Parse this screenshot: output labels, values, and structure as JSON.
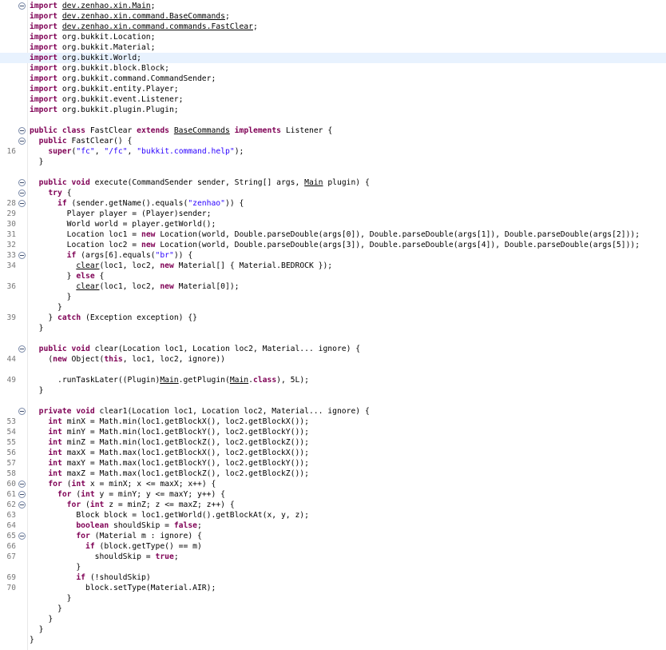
{
  "lines": [
    {
      "ln": "",
      "fold": true,
      "hl": false,
      "segs": [
        [
          "import ",
          "k"
        ],
        [
          "dev.zenhao.xin.Main",
          "u"
        ],
        [
          ";",
          ""
        ]
      ]
    },
    {
      "ln": "",
      "fold": false,
      "hl": false,
      "segs": [
        [
          "import ",
          "k"
        ],
        [
          "dev.zenhao.xin.command.BaseCommands",
          "u"
        ],
        [
          ";",
          ""
        ]
      ]
    },
    {
      "ln": "",
      "fold": false,
      "hl": false,
      "segs": [
        [
          "import ",
          "k"
        ],
        [
          "dev.zenhao.xin.command.commands.FastClear",
          "u"
        ],
        [
          ";",
          ""
        ]
      ]
    },
    {
      "ln": "",
      "fold": false,
      "hl": false,
      "segs": [
        [
          "import ",
          "k"
        ],
        [
          "org.bukkit.Location;",
          ""
        ]
      ]
    },
    {
      "ln": "",
      "fold": false,
      "hl": false,
      "segs": [
        [
          "import ",
          "k"
        ],
        [
          "org.bukkit.Material;",
          ""
        ]
      ]
    },
    {
      "ln": "",
      "fold": false,
      "hl": true,
      "segs": [
        [
          "import ",
          "k"
        ],
        [
          "org.bukkit.World;",
          ""
        ]
      ]
    },
    {
      "ln": "",
      "fold": false,
      "hl": false,
      "segs": [
        [
          "import ",
          "k"
        ],
        [
          "org.bukkit.block.Block;",
          ""
        ]
      ]
    },
    {
      "ln": "",
      "fold": false,
      "hl": false,
      "segs": [
        [
          "import ",
          "k"
        ],
        [
          "org.bukkit.command.CommandSender;",
          ""
        ]
      ]
    },
    {
      "ln": "",
      "fold": false,
      "hl": false,
      "segs": [
        [
          "import ",
          "k"
        ],
        [
          "org.bukkit.entity.Player;",
          ""
        ]
      ]
    },
    {
      "ln": "",
      "fold": false,
      "hl": false,
      "segs": [
        [
          "import ",
          "k"
        ],
        [
          "org.bukkit.event.Listener;",
          ""
        ]
      ]
    },
    {
      "ln": "",
      "fold": false,
      "hl": false,
      "segs": [
        [
          "import ",
          "k"
        ],
        [
          "org.bukkit.plugin.Plugin;",
          ""
        ]
      ]
    },
    {
      "ln": "",
      "fold": false,
      "hl": false,
      "segs": []
    },
    {
      "ln": "",
      "fold": true,
      "hl": false,
      "segs": [
        [
          "public class ",
          "k"
        ],
        [
          "FastClear ",
          ""
        ],
        [
          "extends ",
          "k"
        ],
        [
          "BaseCommands",
          "u"
        ],
        [
          " ",
          ""
        ],
        [
          "implements ",
          "k"
        ],
        [
          "Listener {",
          ""
        ]
      ]
    },
    {
      "ln": "",
      "fold": true,
      "hl": false,
      "segs": [
        [
          "  ",
          ""
        ],
        [
          "public ",
          "k"
        ],
        [
          "FastClear() {",
          ""
        ]
      ]
    },
    {
      "ln": "16",
      "fold": false,
      "hl": false,
      "segs": [
        [
          "    ",
          ""
        ],
        [
          "super",
          "k"
        ],
        [
          "(",
          ""
        ],
        [
          "\"fc\"",
          "s"
        ],
        [
          ", ",
          ""
        ],
        [
          "\"/fc\"",
          "s"
        ],
        [
          ", ",
          ""
        ],
        [
          "\"bukkit.command.help\"",
          "s"
        ],
        [
          ");",
          ""
        ]
      ]
    },
    {
      "ln": "",
      "fold": false,
      "hl": false,
      "segs": [
        [
          "  }",
          ""
        ]
      ]
    },
    {
      "ln": "",
      "fold": false,
      "hl": false,
      "segs": []
    },
    {
      "ln": "",
      "fold": true,
      "hl": false,
      "segs": [
        [
          "  ",
          ""
        ],
        [
          "public void ",
          "k"
        ],
        [
          "execute(CommandSender sender, String[] args, ",
          ""
        ],
        [
          "Main",
          "u"
        ],
        [
          " plugin) {",
          ""
        ]
      ]
    },
    {
      "ln": "",
      "fold": true,
      "hl": false,
      "segs": [
        [
          "    ",
          ""
        ],
        [
          "try ",
          "k"
        ],
        [
          "{",
          ""
        ]
      ]
    },
    {
      "ln": "28",
      "fold": true,
      "hl": false,
      "segs": [
        [
          "      ",
          ""
        ],
        [
          "if ",
          "k"
        ],
        [
          "(sender.getName().equals(",
          ""
        ],
        [
          "\"zenhao\"",
          "s"
        ],
        [
          ")) {",
          ""
        ]
      ]
    },
    {
      "ln": "29",
      "fold": false,
      "hl": false,
      "segs": [
        [
          "        Player player = (Player)sender;",
          ""
        ]
      ]
    },
    {
      "ln": "30",
      "fold": false,
      "hl": false,
      "segs": [
        [
          "        World world = player.getWorld();",
          ""
        ]
      ]
    },
    {
      "ln": "31",
      "fold": false,
      "hl": false,
      "segs": [
        [
          "        Location loc1 = ",
          ""
        ],
        [
          "new ",
          "k"
        ],
        [
          "Location(world, Double.parseDouble(args[0]), Double.parseDouble(args[1]), Double.parseDouble(args[2]));",
          ""
        ]
      ]
    },
    {
      "ln": "32",
      "fold": false,
      "hl": false,
      "segs": [
        [
          "        Location loc2 = ",
          ""
        ],
        [
          "new ",
          "k"
        ],
        [
          "Location(world, Double.parseDouble(args[3]), Double.parseDouble(args[4]), Double.parseDouble(args[5]));",
          ""
        ]
      ]
    },
    {
      "ln": "33",
      "fold": true,
      "hl": false,
      "segs": [
        [
          "        ",
          ""
        ],
        [
          "if ",
          "k"
        ],
        [
          "(args[6].equals(",
          ""
        ],
        [
          "\"br\"",
          "s"
        ],
        [
          ")) {",
          ""
        ]
      ]
    },
    {
      "ln": "34",
      "fold": false,
      "hl": false,
      "segs": [
        [
          "          ",
          ""
        ],
        [
          "clear",
          "u"
        ],
        [
          "(loc1, loc2, ",
          ""
        ],
        [
          "new ",
          "k"
        ],
        [
          "Material[] { Material.BEDROCK });",
          ""
        ]
      ]
    },
    {
      "ln": "",
      "fold": false,
      "hl": false,
      "segs": [
        [
          "        } ",
          ""
        ],
        [
          "else ",
          "k"
        ],
        [
          "{",
          ""
        ]
      ]
    },
    {
      "ln": "36",
      "fold": false,
      "hl": false,
      "segs": [
        [
          "          ",
          ""
        ],
        [
          "clear",
          "u"
        ],
        [
          "(loc1, loc2, ",
          ""
        ],
        [
          "new ",
          "k"
        ],
        [
          "Material[0]);",
          ""
        ]
      ]
    },
    {
      "ln": "",
      "fold": false,
      "hl": false,
      "segs": [
        [
          "        }",
          ""
        ]
      ]
    },
    {
      "ln": "",
      "fold": false,
      "hl": false,
      "segs": [
        [
          "      }",
          ""
        ]
      ]
    },
    {
      "ln": "39",
      "fold": false,
      "hl": false,
      "segs": [
        [
          "    } ",
          ""
        ],
        [
          "catch ",
          "k"
        ],
        [
          "(Exception exception) {}",
          ""
        ]
      ]
    },
    {
      "ln": "",
      "fold": false,
      "hl": false,
      "segs": [
        [
          "  }",
          ""
        ]
      ]
    },
    {
      "ln": "",
      "fold": false,
      "hl": false,
      "segs": []
    },
    {
      "ln": "",
      "fold": true,
      "hl": false,
      "segs": [
        [
          "  ",
          ""
        ],
        [
          "public void ",
          "k"
        ],
        [
          "clear(Location loc1, Location loc2, Material... ignore) {",
          ""
        ]
      ]
    },
    {
      "ln": "44",
      "fold": false,
      "hl": false,
      "segs": [
        [
          "    (",
          ""
        ],
        [
          "new ",
          "k"
        ],
        [
          "Object(",
          ""
        ],
        [
          "this",
          "k"
        ],
        [
          ", loc1, loc2, ignore))",
          ""
        ]
      ]
    },
    {
      "ln": "",
      "fold": false,
      "hl": false,
      "segs": []
    },
    {
      "ln": "49",
      "fold": false,
      "hl": false,
      "segs": [
        [
          "      .runTaskLater((Plugin)",
          ""
        ],
        [
          "Main",
          "u"
        ],
        [
          ".getPlugin(",
          ""
        ],
        [
          "Main",
          "u"
        ],
        [
          ".",
          ""
        ],
        [
          "class",
          "k"
        ],
        [
          "), 5L);",
          ""
        ]
      ]
    },
    {
      "ln": "",
      "fold": false,
      "hl": false,
      "segs": [
        [
          "  }",
          ""
        ]
      ]
    },
    {
      "ln": "",
      "fold": false,
      "hl": false,
      "segs": []
    },
    {
      "ln": "",
      "fold": true,
      "hl": false,
      "segs": [
        [
          "  ",
          ""
        ],
        [
          "private void ",
          "k"
        ],
        [
          "clear1(Location loc1, Location loc2, Material... ignore) {",
          ""
        ]
      ]
    },
    {
      "ln": "53",
      "fold": false,
      "hl": false,
      "segs": [
        [
          "    ",
          ""
        ],
        [
          "int ",
          "k"
        ],
        [
          "minX = Math.min(loc1.getBlockX(), loc2.getBlockX());",
          ""
        ]
      ]
    },
    {
      "ln": "54",
      "fold": false,
      "hl": false,
      "segs": [
        [
          "    ",
          ""
        ],
        [
          "int ",
          "k"
        ],
        [
          "minY = Math.min(loc1.getBlockY(), loc2.getBlockY());",
          ""
        ]
      ]
    },
    {
      "ln": "55",
      "fold": false,
      "hl": false,
      "segs": [
        [
          "    ",
          ""
        ],
        [
          "int ",
          "k"
        ],
        [
          "minZ = Math.min(loc1.getBlockZ(), loc2.getBlockZ());",
          ""
        ]
      ]
    },
    {
      "ln": "56",
      "fold": false,
      "hl": false,
      "segs": [
        [
          "    ",
          ""
        ],
        [
          "int ",
          "k"
        ],
        [
          "maxX = Math.max(loc1.getBlockX(), loc2.getBlockX());",
          ""
        ]
      ]
    },
    {
      "ln": "57",
      "fold": false,
      "hl": false,
      "segs": [
        [
          "    ",
          ""
        ],
        [
          "int ",
          "k"
        ],
        [
          "maxY = Math.max(loc1.getBlockY(), loc2.getBlockY());",
          ""
        ]
      ]
    },
    {
      "ln": "58",
      "fold": false,
      "hl": false,
      "segs": [
        [
          "    ",
          ""
        ],
        [
          "int ",
          "k"
        ],
        [
          "maxZ = Math.max(loc1.getBlockZ(), loc2.getBlockZ());",
          ""
        ]
      ]
    },
    {
      "ln": "60",
      "fold": true,
      "hl": false,
      "segs": [
        [
          "    ",
          ""
        ],
        [
          "for ",
          "k"
        ],
        [
          "(",
          ""
        ],
        [
          "int ",
          "k"
        ],
        [
          "x = minX; x <= maxX; x++) {",
          ""
        ]
      ]
    },
    {
      "ln": "61",
      "fold": true,
      "hl": false,
      "segs": [
        [
          "      ",
          ""
        ],
        [
          "for ",
          "k"
        ],
        [
          "(",
          ""
        ],
        [
          "int ",
          "k"
        ],
        [
          "y = minY; y <= maxY; y++) {",
          ""
        ]
      ]
    },
    {
      "ln": "62",
      "fold": true,
      "hl": false,
      "segs": [
        [
          "        ",
          ""
        ],
        [
          "for ",
          "k"
        ],
        [
          "(",
          ""
        ],
        [
          "int ",
          "k"
        ],
        [
          "z = minZ; z <= maxZ; z++) {",
          ""
        ]
      ]
    },
    {
      "ln": "63",
      "fold": false,
      "hl": false,
      "segs": [
        [
          "          Block block = loc1.getWorld().getBlockAt(x, y, z);",
          ""
        ]
      ]
    },
    {
      "ln": "64",
      "fold": false,
      "hl": false,
      "segs": [
        [
          "          ",
          ""
        ],
        [
          "boolean ",
          "k"
        ],
        [
          "shouldSkip = ",
          ""
        ],
        [
          "false",
          "k"
        ],
        [
          ";",
          ""
        ]
      ]
    },
    {
      "ln": "65",
      "fold": true,
      "hl": false,
      "segs": [
        [
          "          ",
          ""
        ],
        [
          "for ",
          "k"
        ],
        [
          "(Material m : ignore) {",
          ""
        ]
      ]
    },
    {
      "ln": "66",
      "fold": false,
      "hl": false,
      "segs": [
        [
          "            ",
          ""
        ],
        [
          "if ",
          "k"
        ],
        [
          "(block.getType() == m)",
          ""
        ]
      ]
    },
    {
      "ln": "67",
      "fold": false,
      "hl": false,
      "segs": [
        [
          "              shouldSkip = ",
          ""
        ],
        [
          "true",
          "k"
        ],
        [
          ";",
          ""
        ]
      ]
    },
    {
      "ln": "",
      "fold": false,
      "hl": false,
      "segs": [
        [
          "          }",
          ""
        ]
      ]
    },
    {
      "ln": "69",
      "fold": false,
      "hl": false,
      "segs": [
        [
          "          ",
          ""
        ],
        [
          "if ",
          "k"
        ],
        [
          "(!shouldSkip)",
          ""
        ]
      ]
    },
    {
      "ln": "70",
      "fold": false,
      "hl": false,
      "segs": [
        [
          "            block.setType(Material.AIR);",
          ""
        ]
      ]
    },
    {
      "ln": "",
      "fold": false,
      "hl": false,
      "segs": [
        [
          "        }",
          ""
        ]
      ]
    },
    {
      "ln": "",
      "fold": false,
      "hl": false,
      "segs": [
        [
          "      }",
          ""
        ]
      ]
    },
    {
      "ln": "",
      "fold": false,
      "hl": false,
      "segs": [
        [
          "    }",
          ""
        ]
      ]
    },
    {
      "ln": "",
      "fold": false,
      "hl": false,
      "segs": [
        [
          "  }",
          ""
        ]
      ]
    },
    {
      "ln": "",
      "fold": false,
      "hl": false,
      "segs": [
        [
          "}",
          ""
        ]
      ]
    }
  ]
}
